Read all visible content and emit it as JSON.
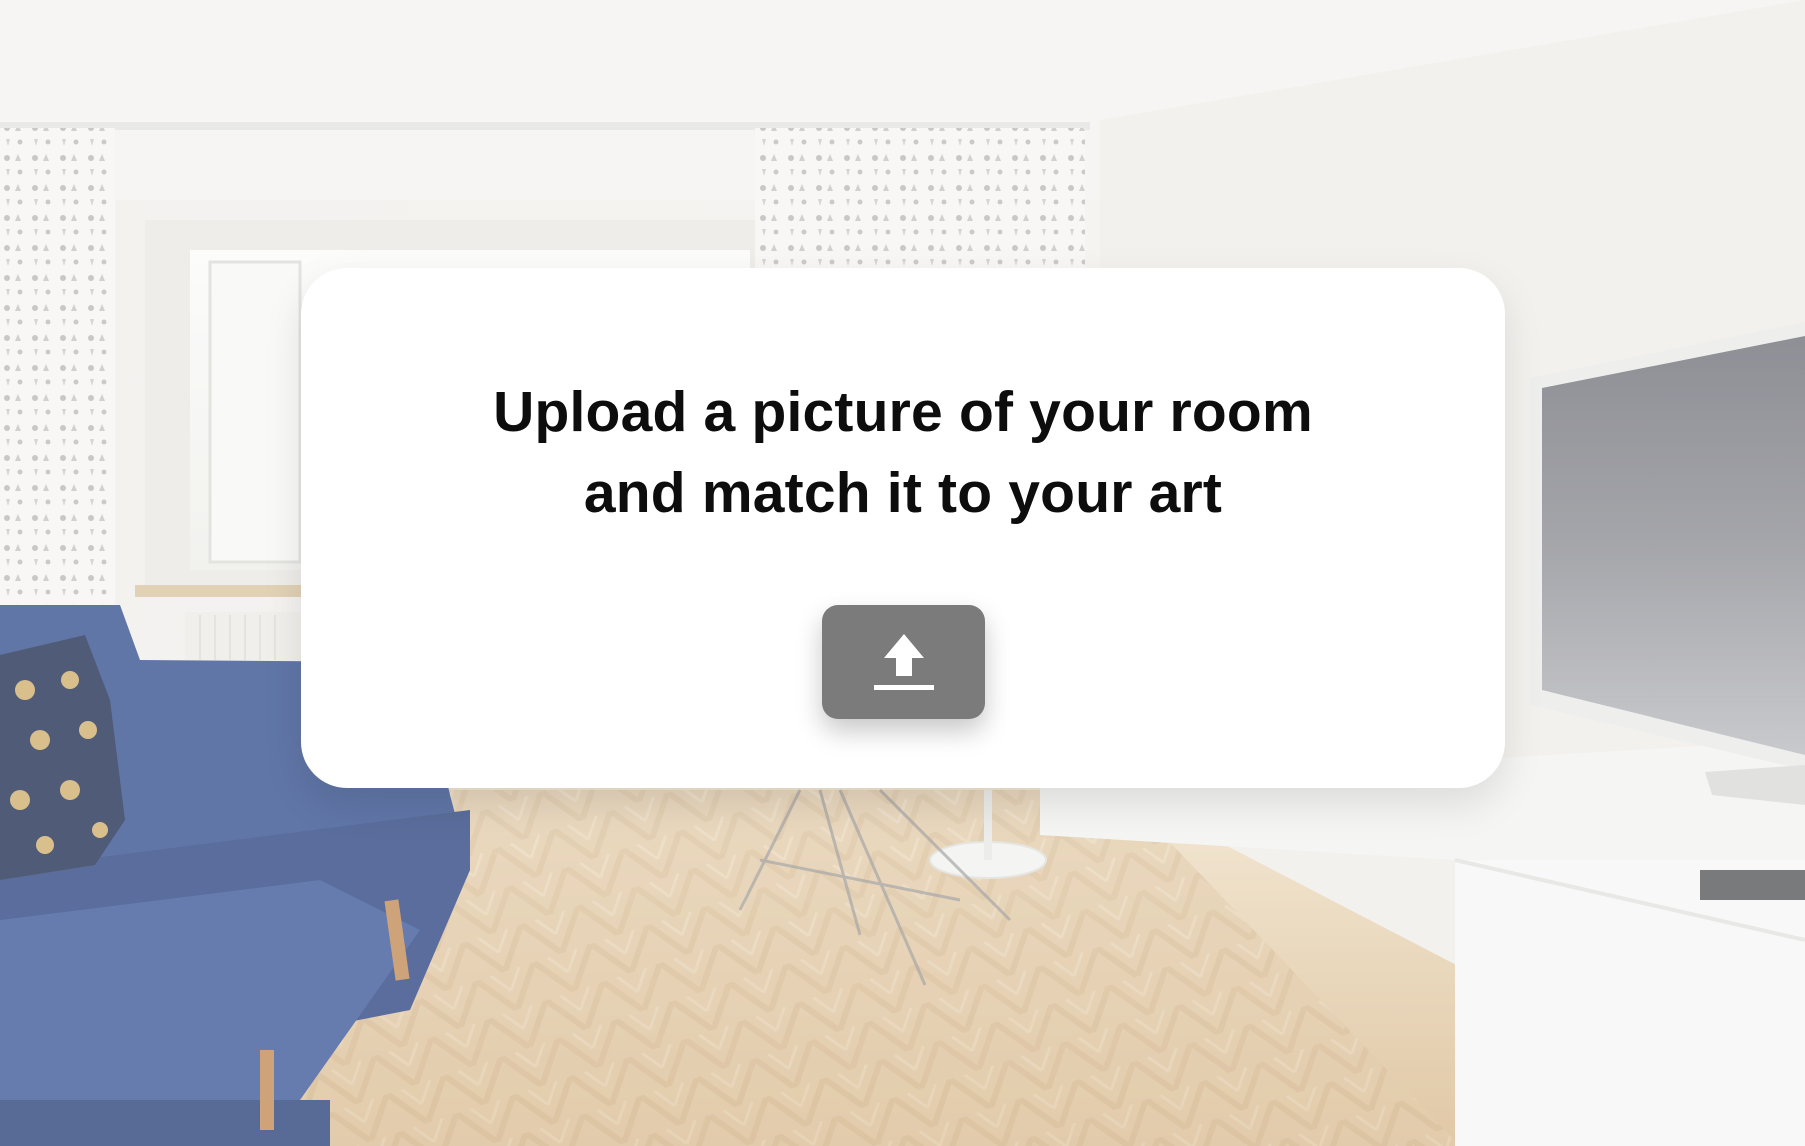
{
  "prompt": {
    "line1": "Upload a picture of your room",
    "line2": "and match it to your art"
  },
  "upload_button": {
    "icon": "upload-icon",
    "aria_label": "Upload"
  },
  "colors": {
    "card_background": "#ffffff",
    "headline_text": "#0d0d0d",
    "button_background": "#7b7b7b",
    "button_icon": "#ffffff",
    "sofa": "#2f4d93",
    "floor": "#d9b98a"
  },
  "background": {
    "scene": "living-room-photo"
  }
}
